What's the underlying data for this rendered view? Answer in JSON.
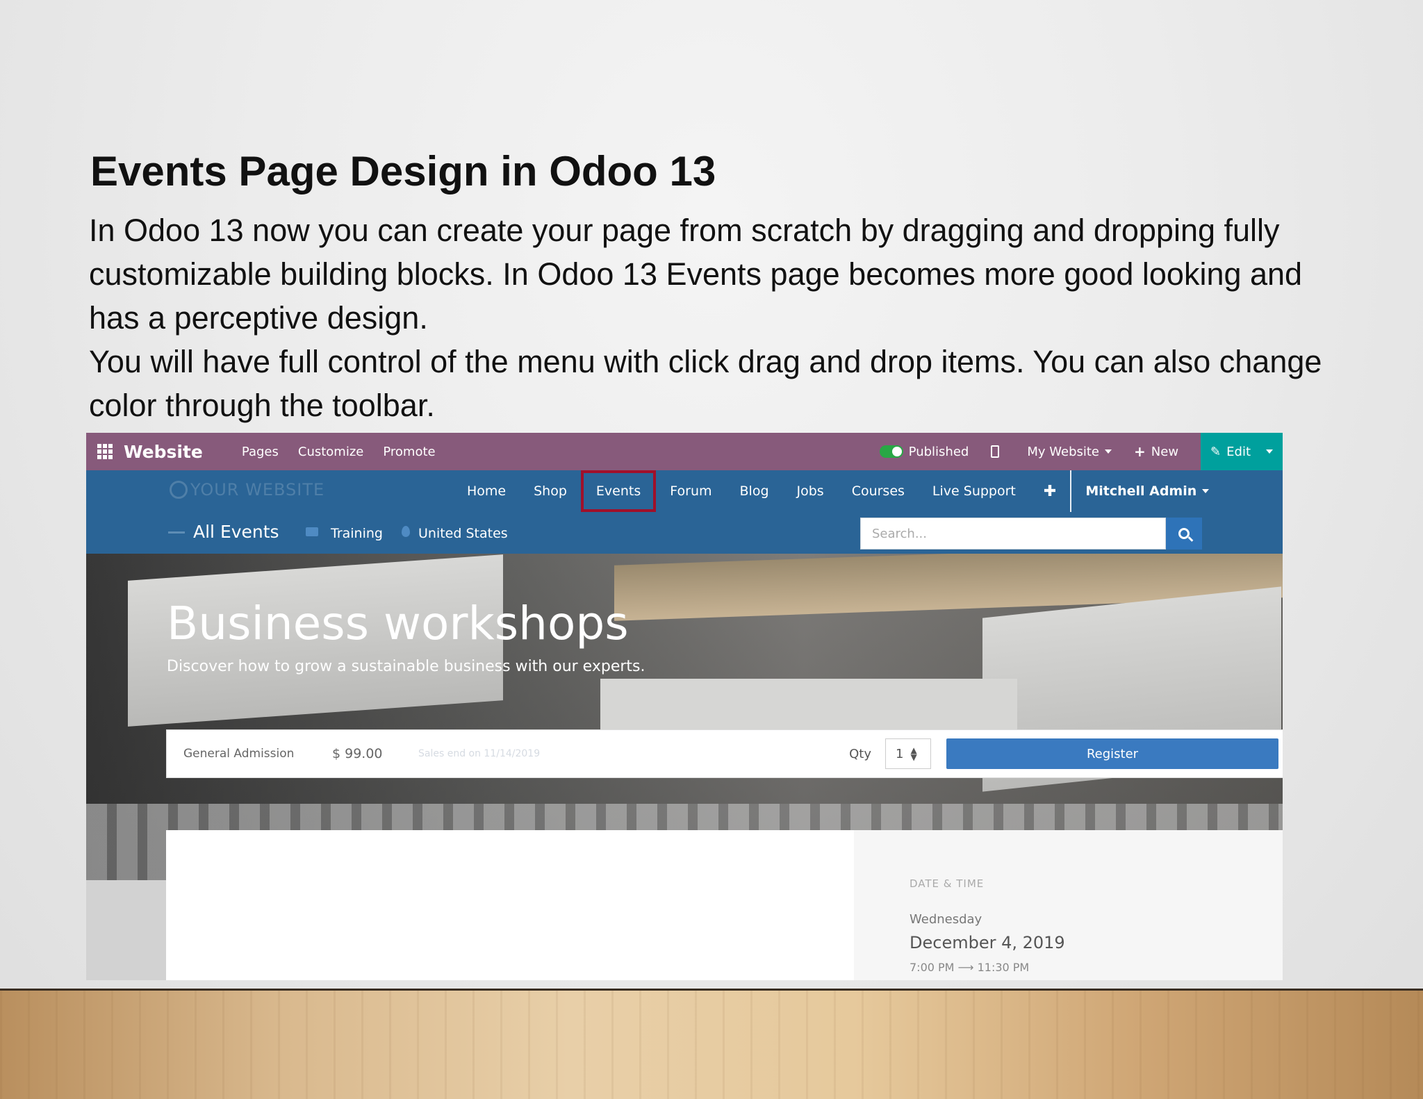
{
  "slide": {
    "title": "Events Page Design in Odoo 13",
    "paragraph1": "In Odoo 13 now you can create your page from scratch by dragging and dropping fully customizable building blocks. In Odoo 13 Events page becomes more good looking and has a perceptive design.",
    "paragraph2": "You will have full control of the menu with click drag and drop items. You can also change color through the toolbar."
  },
  "topbar": {
    "brand": "Website",
    "menu": [
      "Pages",
      "Customize",
      "Promote"
    ],
    "published_label": "Published",
    "my_website_label": "My Website",
    "new_label": "New",
    "edit_label": "Edit",
    "bg_color": "#875a7b",
    "edit_color": "#00a09d"
  },
  "navbar": {
    "logo_text": "YOUR WEBSITE",
    "links": [
      "Home",
      "Shop",
      "Events",
      "Forum",
      "Blog",
      "Jobs",
      "Courses",
      "Live Support"
    ],
    "active_link": "Events",
    "plus": "✚",
    "user": "Mitchell Admin",
    "bg_color": "#2a6496",
    "highlight_color": "#a0102a"
  },
  "subbar": {
    "all_events": "All Events",
    "category": "Training",
    "country": "United States",
    "search_placeholder": "Search..."
  },
  "hero": {
    "title": "Business workshops",
    "subtitle": "Discover how to grow a sustainable business with our experts."
  },
  "ticket": {
    "name": "General Admission",
    "price": "$ 99.00",
    "sales_end": "Sales end on 11/14/2019",
    "qty_label": "Qty",
    "qty_value": "1",
    "register_label": "Register"
  },
  "date_time": {
    "label": "DATE & TIME",
    "day": "Wednesday",
    "date": "December 4, 2019",
    "time": "7:00 PM ⟶ 11:30 PM"
  }
}
